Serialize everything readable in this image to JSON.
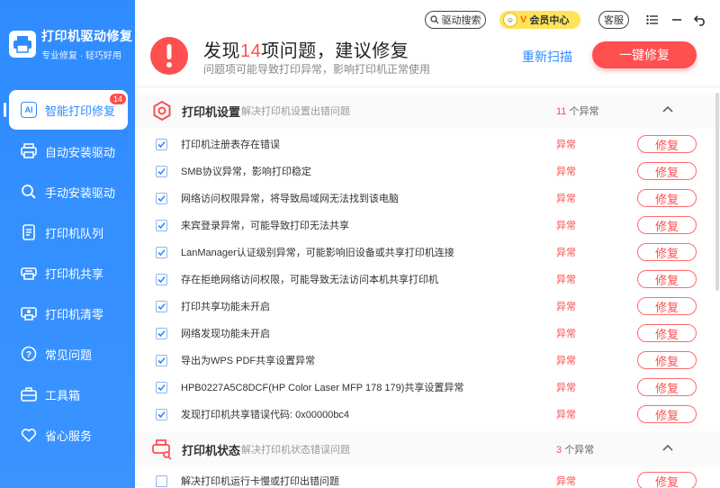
{
  "brand": {
    "title": "打印机驱动修复",
    "subtitle": "专业修复 · 轻巧好用"
  },
  "topbar": {
    "search_label": "驱动搜索",
    "vip_label": "会员中心",
    "vip_v": "V",
    "service_label": "客服"
  },
  "nav": {
    "active": {
      "label": "智能打印修复",
      "badge": "14",
      "icon_text": "AI"
    },
    "items": [
      {
        "label": "自动安装驱动",
        "icon": "printer-icon"
      },
      {
        "label": "手动安装驱动",
        "icon": "search-icon"
      },
      {
        "label": "打印机队列",
        "icon": "queue-icon"
      },
      {
        "label": "打印机共享",
        "icon": "share-printer-icon"
      },
      {
        "label": "打印机清零",
        "icon": "reset-icon"
      },
      {
        "label": "常见问题",
        "icon": "question-icon"
      },
      {
        "label": "工具箱",
        "icon": "toolbox-icon"
      },
      {
        "label": "省心服务",
        "icon": "heart-icon"
      }
    ]
  },
  "alert": {
    "title_prefix": "发现",
    "count": "14",
    "title_suffix": "项问题，建议修复",
    "subtitle": "问题项可能导致打印异常，影响打印机正常使用",
    "rescan_label": "重新扫描",
    "fix_all_label": "一键修复"
  },
  "sections": [
    {
      "title": "打印机设置",
      "desc": "解决打印机设置出错问题",
      "count": "11",
      "count_suffix": "个异常",
      "items": [
        {
          "text": "打印机注册表存在错误",
          "status": "异常",
          "action": "修复",
          "checked": true
        },
        {
          "text": "SMB协议异常，影响打印稳定",
          "status": "异常",
          "action": "修复",
          "checked": true
        },
        {
          "text": "网络访问权限异常，将导致局域网无法找到该电脑",
          "status": "异常",
          "action": "修复",
          "checked": true
        },
        {
          "text": "来宾登录异常，可能导致打印无法共享",
          "status": "异常",
          "action": "修复",
          "checked": true
        },
        {
          "text": "LanManager认证级别异常，可能影响旧设备或共享打印机连接",
          "status": "异常",
          "action": "修复",
          "checked": true
        },
        {
          "text": "存在拒绝网络访问权限，可能导致无法访问本机共享打印机",
          "status": "异常",
          "action": "修复",
          "checked": true
        },
        {
          "text": "打印共享功能未开启",
          "status": "异常",
          "action": "修复",
          "checked": true
        },
        {
          "text": "网络发现功能未开启",
          "status": "异常",
          "action": "修复",
          "checked": true
        },
        {
          "text": "导出为WPS PDF共享设置异常",
          "status": "异常",
          "action": "修复",
          "checked": true
        },
        {
          "text": "HPB0227A5C8DCF(HP Color Laser MFP 178 179)共享设置异常",
          "status": "异常",
          "action": "修复",
          "checked": true
        },
        {
          "text": "发现打印机共享错误代码: 0x00000bc4",
          "status": "异常",
          "action": "修复",
          "checked": true
        }
      ]
    },
    {
      "title": "打印机状态",
      "desc": "解决打印机状态错误问题",
      "count": "3",
      "count_suffix": "个异常",
      "items": [
        {
          "text": "解决打印机运行卡慢或打印出错问题",
          "status": "异常",
          "action": "修复",
          "checked": false
        }
      ]
    }
  ],
  "colors": {
    "primary": "#2f8cff",
    "danger": "#ff4e4e",
    "vip": "#ffe35a"
  }
}
